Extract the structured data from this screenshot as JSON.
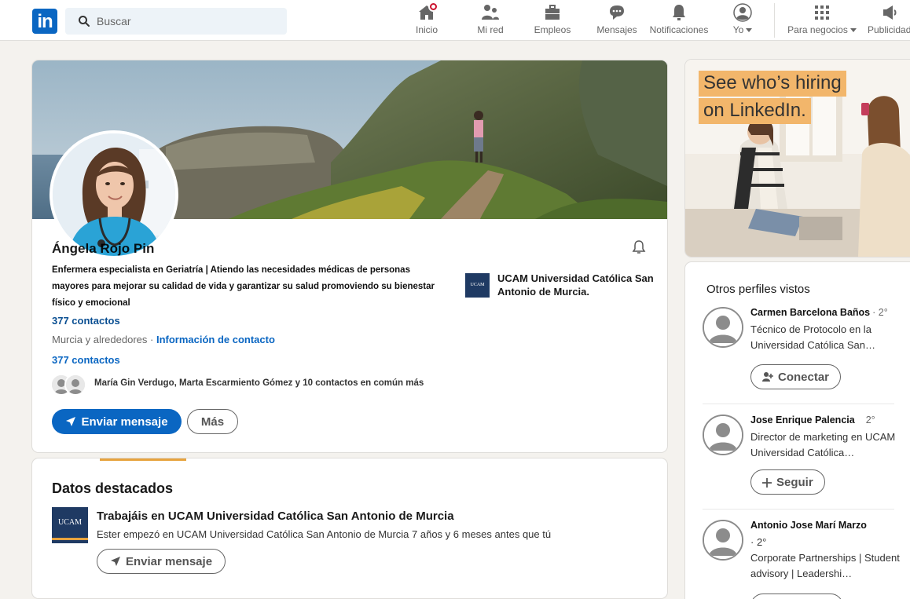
{
  "nav": {
    "search_placeholder": "Buscar",
    "items": [
      {
        "label": "Inicio",
        "icon": "home-icon"
      },
      {
        "label": "Mi red",
        "icon": "network-icon"
      },
      {
        "label": "Empleos",
        "icon": "briefcase-icon"
      },
      {
        "label": "Mensajes",
        "icon": "messaging-icon"
      },
      {
        "label": "Notificaciones",
        "icon": "bell-icon"
      },
      {
        "label": "Yo",
        "icon": "avatar-icon"
      },
      {
        "label": "Para negocios",
        "icon": "grid-icon"
      },
      {
        "label": "Publicidad",
        "icon": "ad-icon"
      }
    ],
    "brand_color": "#0a66c2"
  },
  "profile": {
    "name": "Ángela Rojo Pin",
    "headline": "Enfermera especialista en Geriatría | Atiendo las necesidades médicas de personas mayores para mejorar su calidad de vida y garantizar su salud promoviendo su bienestar físico y emocional",
    "education": {
      "logo_text": "UCAM",
      "name": "UCAM Universidad Católica San Antonio de Murcia."
    },
    "contacts_primary": "377 contactos",
    "location": "Murcia y alrededores",
    "location_separator": " · ",
    "contact_info_link": "Información de contacto",
    "contacts_secondary": "377 contactos",
    "mutual_text": "María Gin Verdugo, Marta Escarmiento Gómez y 10 contactos en común más",
    "send_message_label": "Enviar mensaje",
    "more_label": "Más"
  },
  "highlights": {
    "title": "Datos destacados",
    "logo_text": "UCAM",
    "heading": "Trabajáis en UCAM Universidad Católica San Antonio de Murcia",
    "subtext": "Ester empezó en UCAM Universidad Católica San Antonio de Murcia 7 años y 6 meses antes que tú",
    "button_label": "Enviar mensaje"
  },
  "ad": {
    "line1": "See who’s hiring",
    "line2": "on LinkedIn.",
    "highlight_color": "#f2b66b"
  },
  "others": {
    "title": "Otros perfiles vistos",
    "people": [
      {
        "name": "Carmen Barcelona Baños",
        "degree": "· 2°",
        "desc": "Técnico de Protocolo en la Universidad Católica San…",
        "button": "Conectar",
        "button_icon": "add-person-icon"
      },
      {
        "name": "Jose Enrique Palencia",
        "degree": "2°",
        "desc": "Director de marketing en UCAM Universidad Católica…",
        "button": "Seguir",
        "button_icon": "plus-icon"
      },
      {
        "name": "Antonio Jose Marí Marzo",
        "degree": "· 2°",
        "desc": "Corporate Partnerships | Student advisory | Leadershi…",
        "button": "",
        "button_icon": ""
      }
    ]
  }
}
